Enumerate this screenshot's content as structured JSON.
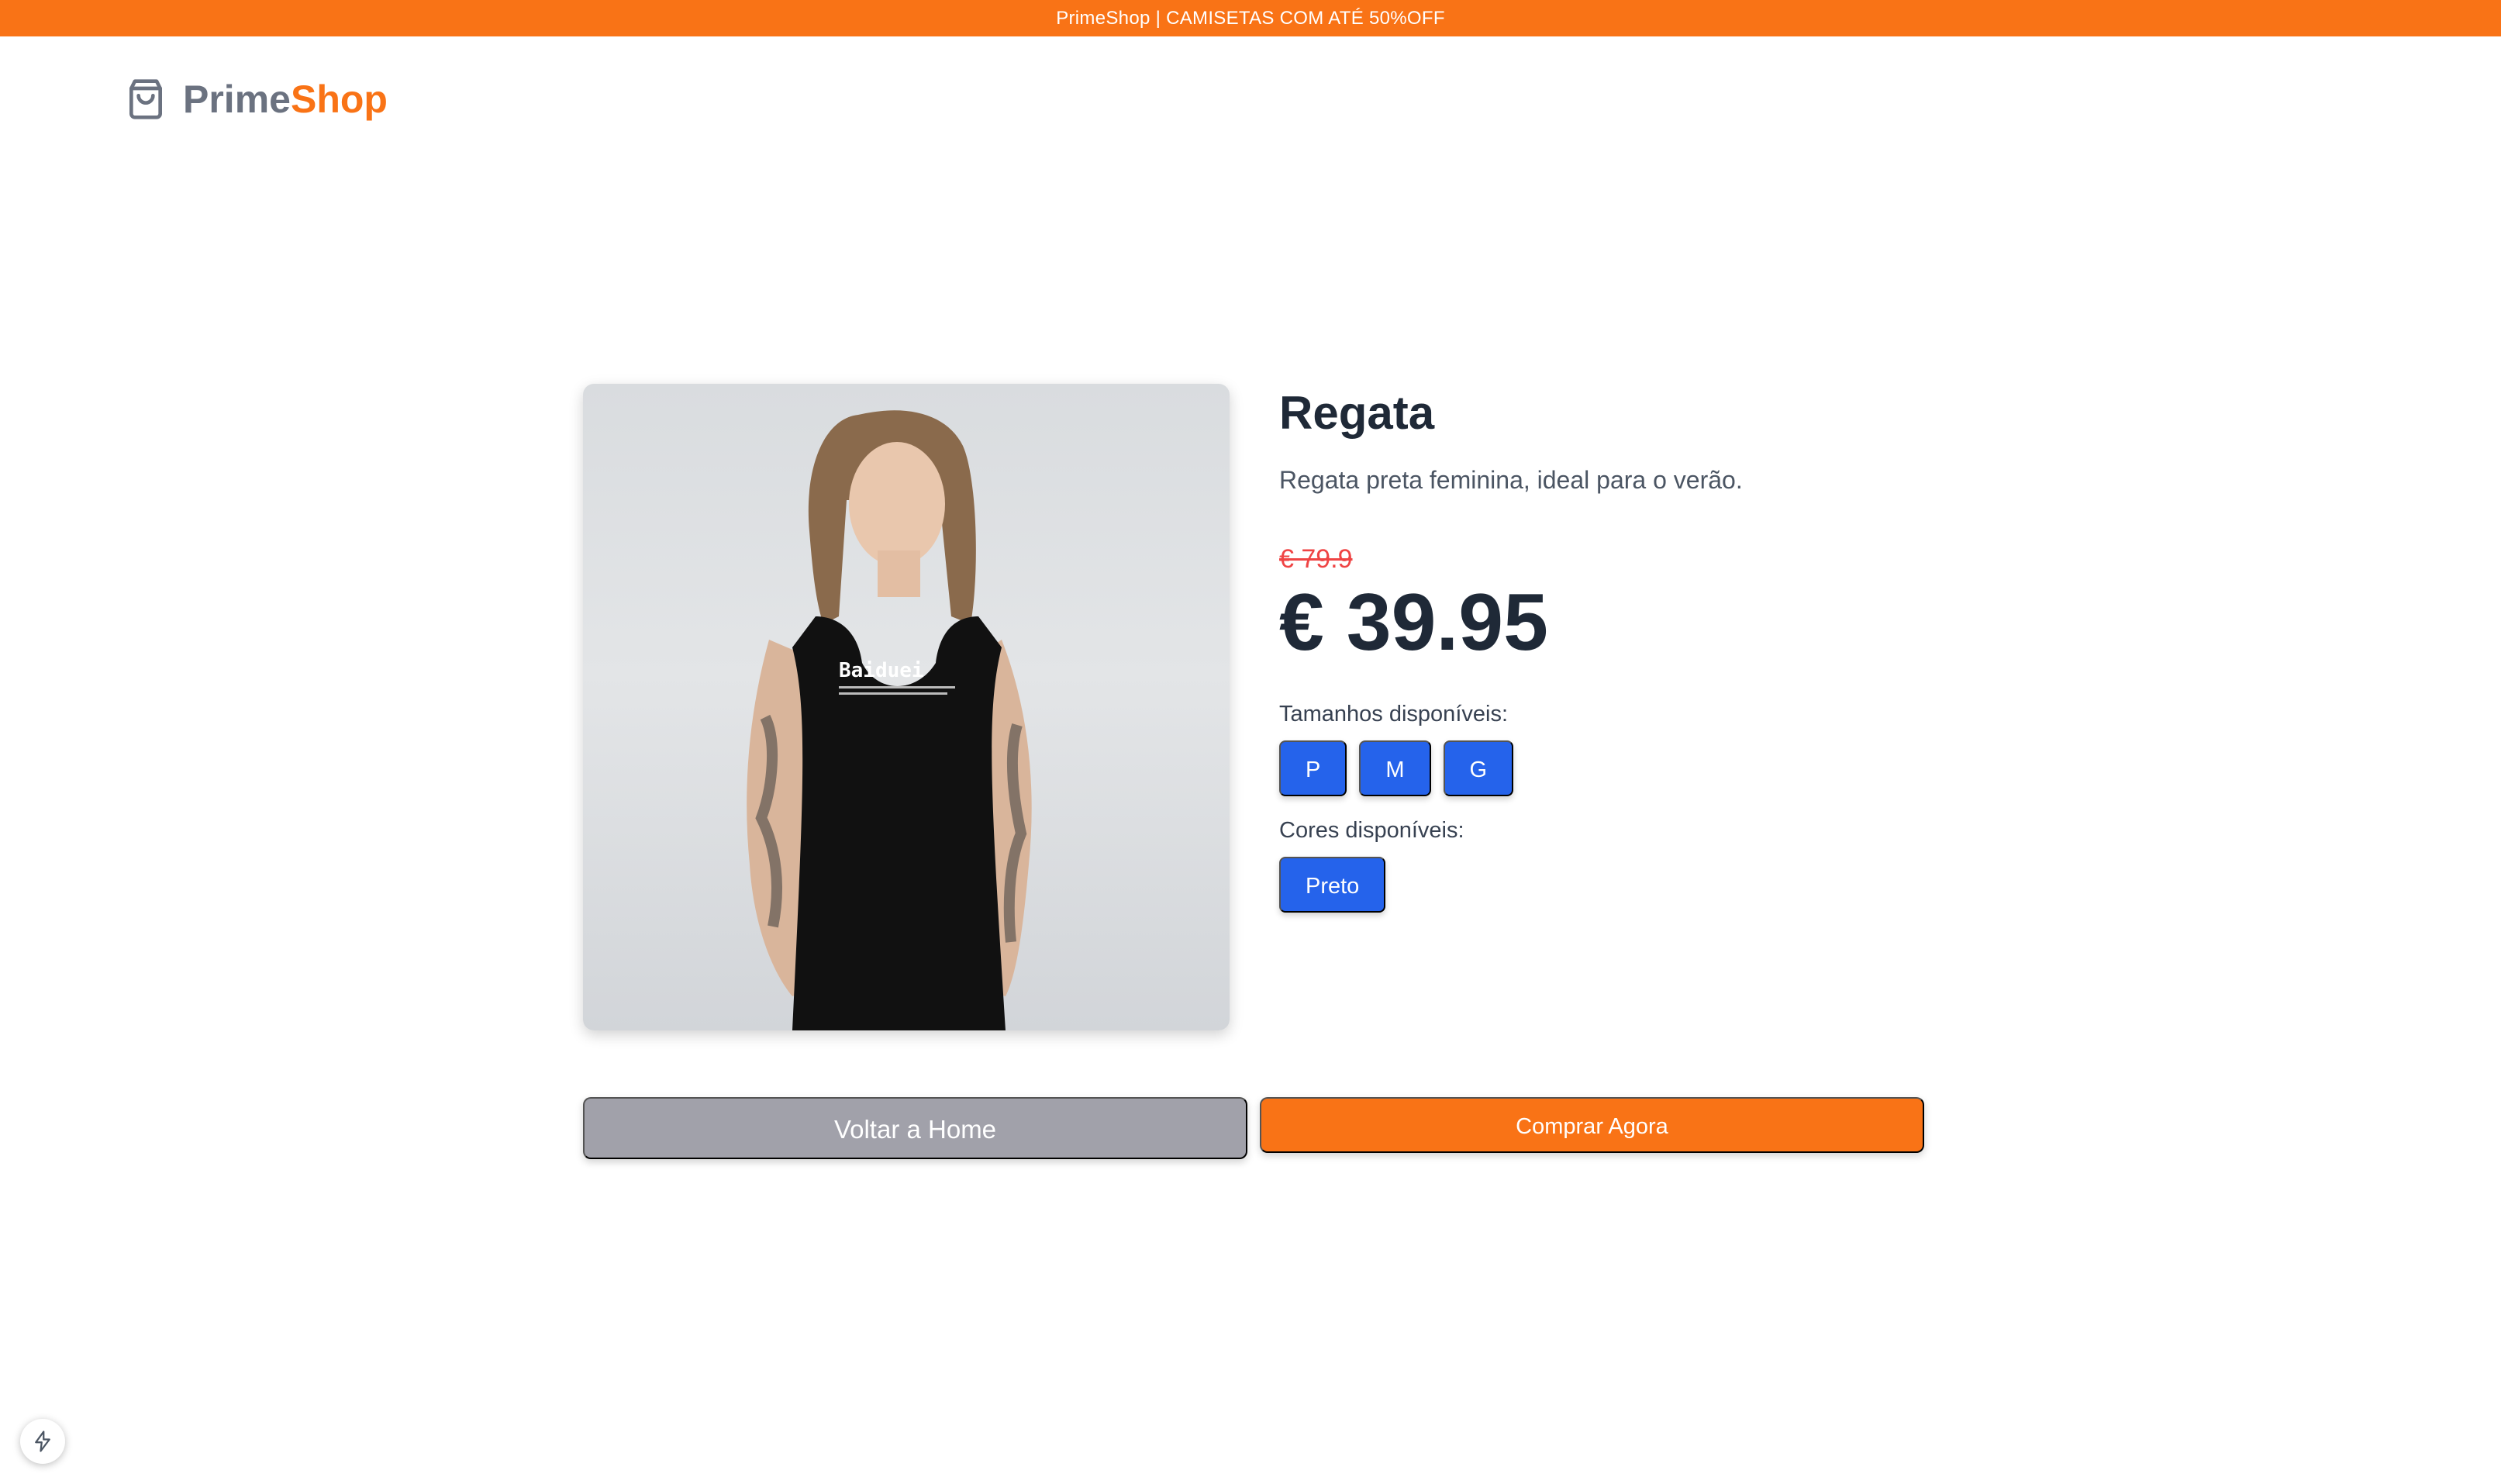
{
  "promo": {
    "text": "PrimeShop | CAMISETAS COM ATÉ 50%OFF"
  },
  "header": {
    "logo_icon": "shopping-bag-icon",
    "logo_part1": "Prime",
    "logo_part2": "Shop"
  },
  "product": {
    "image_alt": "Regata",
    "print_text": "Baiduei",
    "title": "Regata",
    "description": "Regata preta feminina, ideal para o verão.",
    "old_price": "€ 79.9",
    "price": "€ 39.95",
    "sizes_label": "Tamanhos disponíveis:",
    "sizes": [
      "P",
      "M",
      "G"
    ],
    "colors_label": "Cores disponíveis:",
    "colors": [
      "Preto"
    ]
  },
  "actions": {
    "home_label": "Voltar a Home",
    "buy_label": "Comprar Agora"
  },
  "dev_indicator": {
    "icon": "lightning-icon"
  },
  "colors": {
    "accent": "#f97316",
    "chip": "#2563eb",
    "old_price": "#ef4444",
    "muted_button": "#a1a1aa",
    "text_dark": "#1f2937"
  }
}
